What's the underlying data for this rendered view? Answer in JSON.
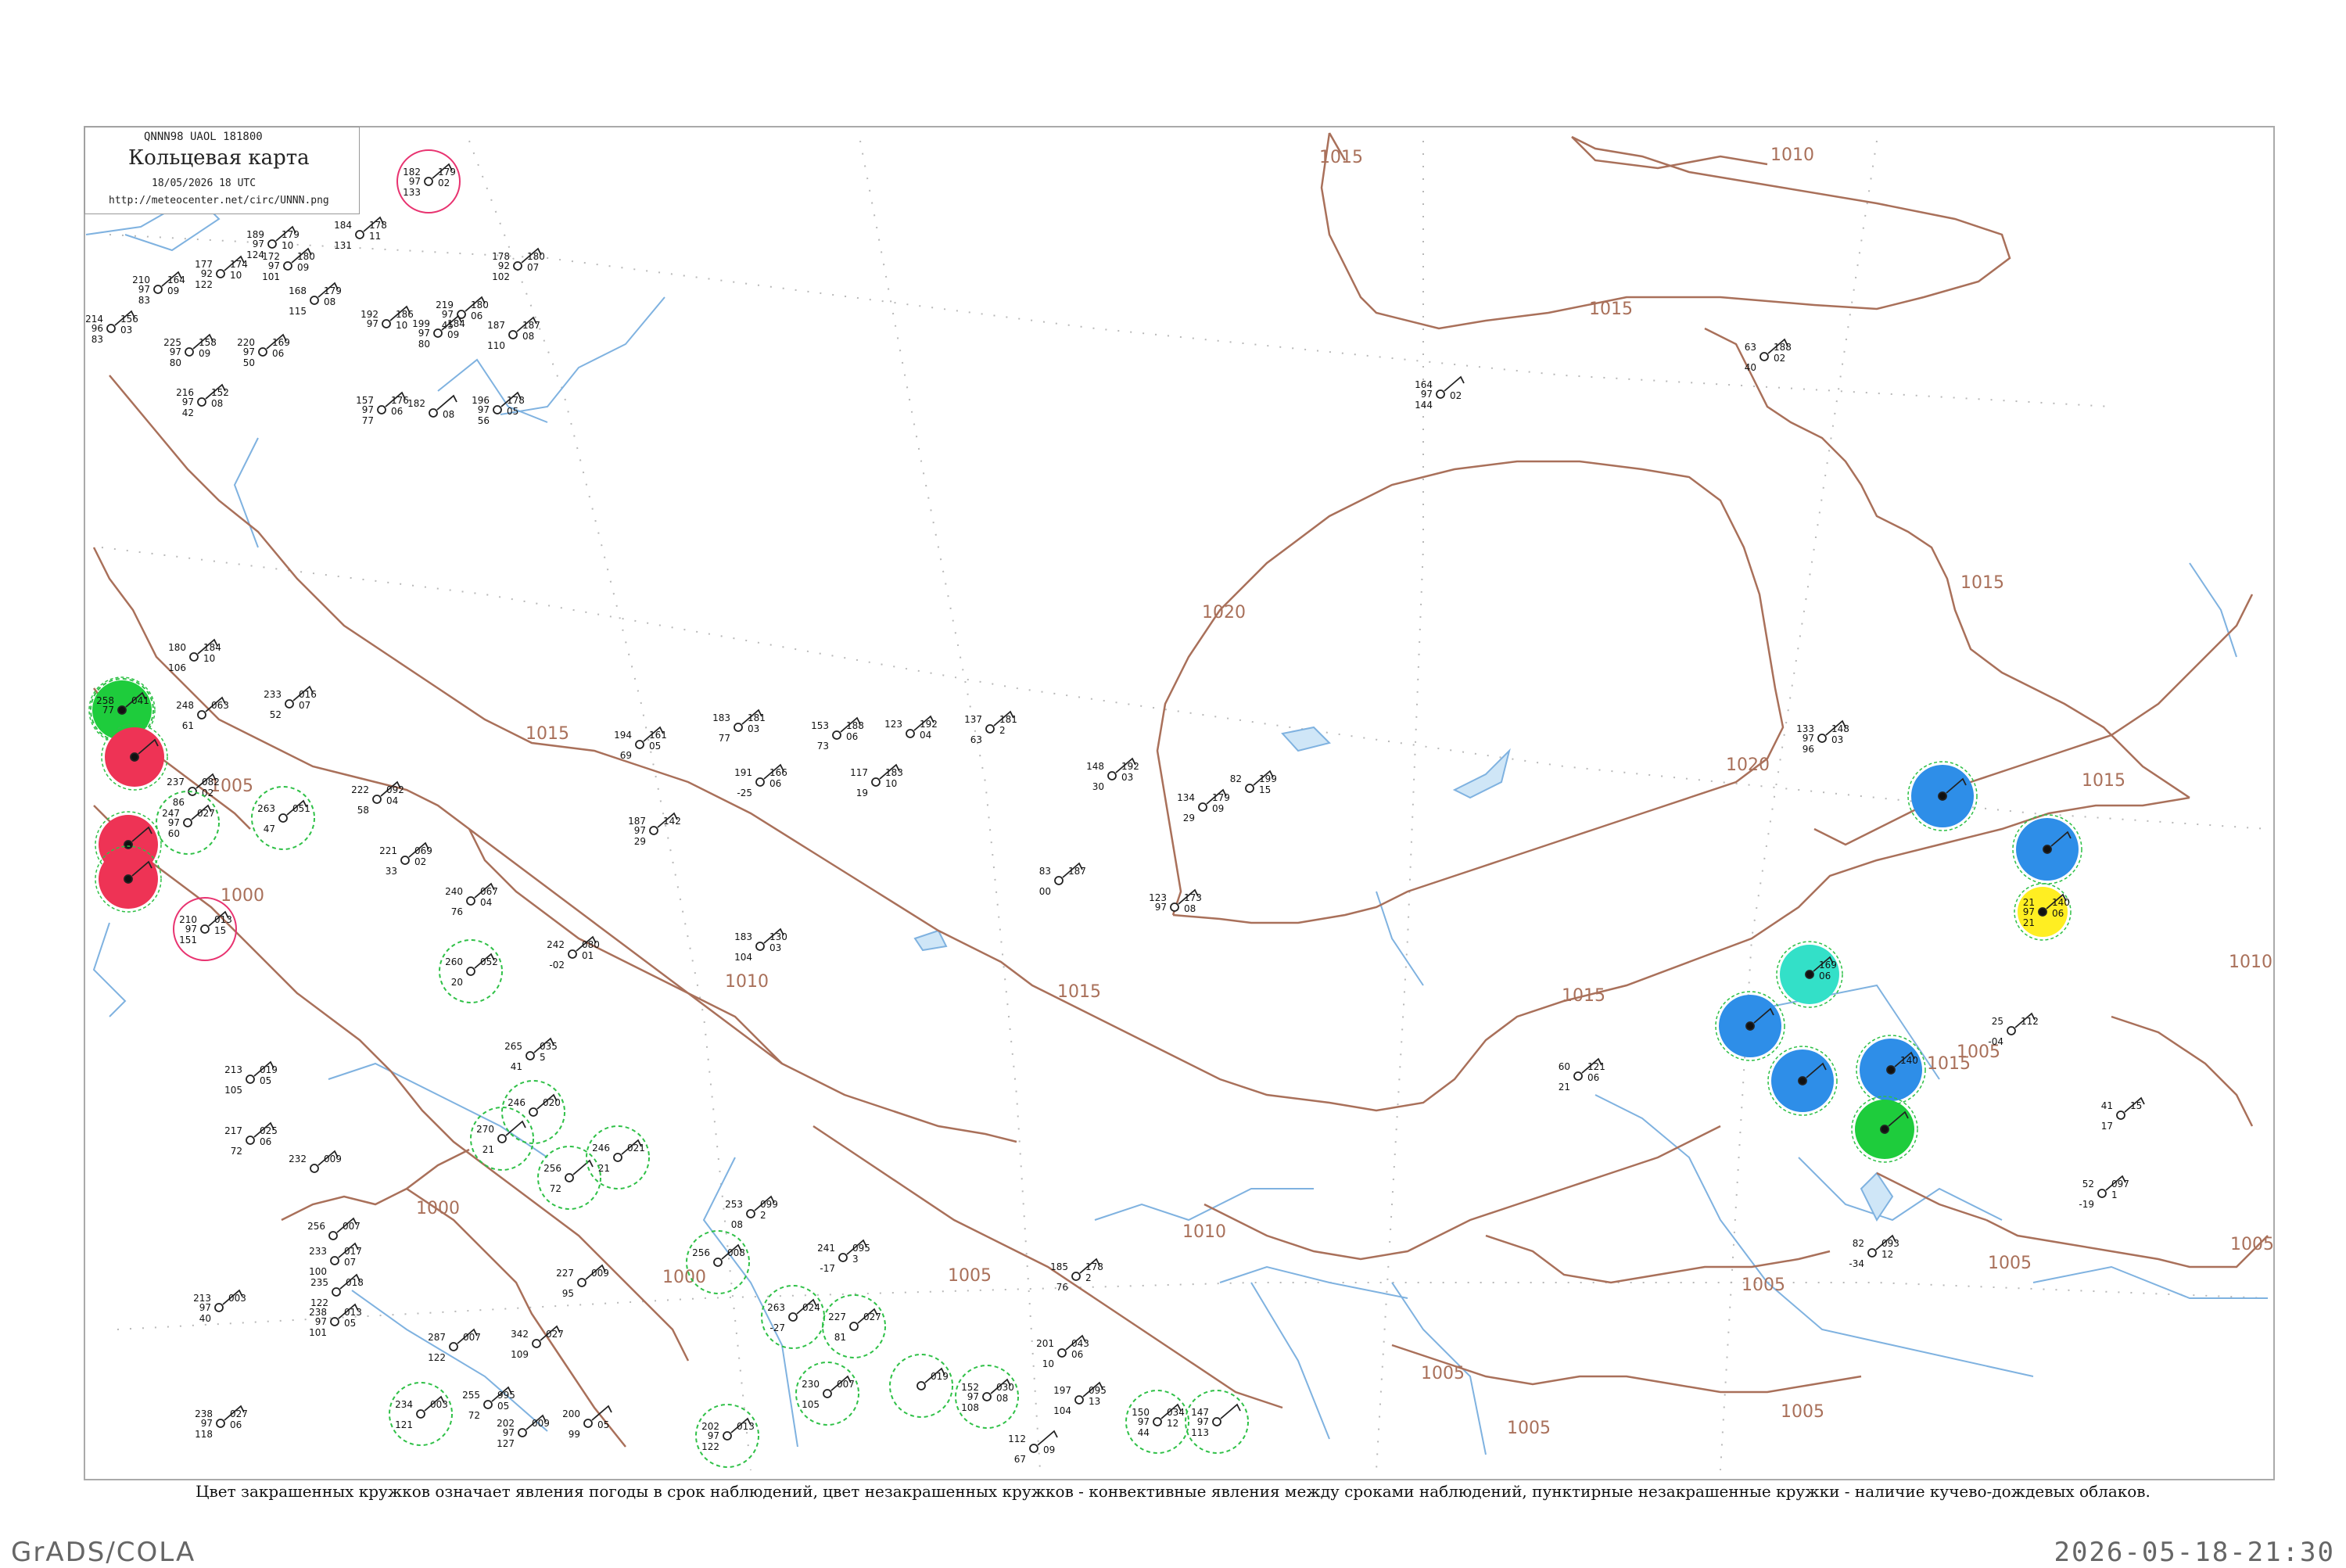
{
  "header": {
    "codes": "QNNN98  UAOL  181800",
    "title": "Кольцевая карта",
    "datetime": "18/05/2026 18 UTC",
    "url": "http://meteocenter.net/circ/UNNN.png"
  },
  "caption": "Цвет закрашенных кружков означает явления погоды в срок наблюдений, цвет незакрашенных кружков - конвективные явления между сроками наблюдений, пунктирные незакрашенные кружки - наличие кучево-дождевых облаков.",
  "footer": {
    "left": "GrADS/COLA",
    "right": "2026-05-18-21:30"
  },
  "colors": {
    "isobar": "#a9705a",
    "water": "#7fb2e0",
    "station": "#222222",
    "red": "#ee3355",
    "green": "#1ecc3c",
    "blue": "#2e8ee8",
    "cyan": "#33e0c8",
    "yellow": "#ffee22",
    "cb_ring": "#2ec046",
    "ts_ring": "#e83370"
  },
  "isobar_labels": [
    {
      "text": "1015"
    },
    {
      "text": "1010"
    },
    {
      "text": "1015"
    },
    {
      "text": "1015"
    },
    {
      "text": "1020"
    },
    {
      "text": "1020"
    },
    {
      "text": "1015"
    },
    {
      "text": "1015"
    },
    {
      "text": "1015"
    },
    {
      "text": "1010"
    },
    {
      "text": "1015"
    },
    {
      "text": "1005"
    },
    {
      "text": "1005"
    },
    {
      "text": "1000"
    },
    {
      "text": "1010"
    },
    {
      "text": "1015"
    },
    {
      "text": "1000"
    },
    {
      "text": "1000"
    },
    {
      "text": "1005"
    },
    {
      "text": "1010"
    },
    {
      "text": "1005"
    },
    {
      "text": "1005"
    },
    {
      "text": "1005"
    },
    {
      "text": "1005"
    },
    {
      "text": "1005"
    },
    {
      "text": "1005"
    }
  ],
  "stations": [
    {
      "p": "182",
      "t": "97",
      "d": "133",
      "w": "179",
      "v": "02",
      "ring": "ts"
    },
    {
      "p": "189",
      "t": "97",
      "d": "124",
      "w": "179",
      "v": "10"
    },
    {
      "p": "184",
      "t": "",
      "d": "131",
      "w": "178",
      "v": "11"
    },
    {
      "p": "177",
      "t": "92",
      "d": "122",
      "w": "174",
      "v": "10"
    },
    {
      "p": "172",
      "t": "97",
      "d": "101",
      "w": "180",
      "v": "09"
    },
    {
      "p": "210",
      "t": "97",
      "d": "83",
      "w": "164",
      "v": "09"
    },
    {
      "p": "168",
      "t": "",
      "d": "115",
      "w": "179",
      "v": "08"
    },
    {
      "p": "178",
      "t": "92",
      "d": "102",
      "w": "180",
      "v": "07"
    },
    {
      "p": "192",
      "t": "97",
      "d": "",
      "w": "186",
      "v": "10"
    },
    {
      "p": "219",
      "t": "97",
      "d": "45",
      "w": "180",
      "v": "06"
    },
    {
      "p": "199",
      "t": "97",
      "d": "80",
      "w": "184",
      "v": "09"
    },
    {
      "p": "187",
      "t": "",
      "d": "110",
      "w": "187",
      "v": "08"
    },
    {
      "p": "214",
      "t": "96",
      "d": "83",
      "w": "156",
      "v": "03"
    },
    {
      "p": "225",
      "t": "97",
      "d": "80",
      "w": "158",
      "v": "09"
    },
    {
      "p": "220",
      "t": "97",
      "d": "50",
      "w": "169",
      "v": "06"
    },
    {
      "p": "216",
      "t": "97",
      "d": "42",
      "w": "152",
      "v": "08"
    },
    {
      "p": "157",
      "t": "97",
      "d": "77",
      "w": "176",
      "v": "06"
    },
    {
      "p": "182",
      "t": "",
      "d": "",
      "w": "",
      "v": "08"
    },
    {
      "p": "196",
      "t": "97",
      "d": "56",
      "w": "178",
      "v": "05"
    },
    {
      "p": "164",
      "t": "97",
      "d": "144",
      "w": "",
      "v": "02"
    },
    {
      "p": "63",
      "t": "",
      "d": "40",
      "w": "188",
      "v": "02"
    },
    {
      "p": "180",
      "t": "",
      "d": "106",
      "w": "184",
      "v": "10"
    },
    {
      "p": "233",
      "t": "",
      "d": "52",
      "w": "016",
      "v": "07"
    },
    {
      "p": "258",
      "t": "77",
      "d": "",
      "w": "041",
      "v": "",
      "ring": "cb",
      "fill": "green"
    },
    {
      "p": "248",
      "t": "",
      "d": "61",
      "w": "063",
      "v": ""
    },
    {
      "p": "",
      "t": "",
      "d": "",
      "w": "",
      "v": "",
      "fill": "red"
    },
    {
      "p": "237",
      "t": "",
      "d": "86",
      "w": "082",
      "v": "02"
    },
    {
      "p": "222",
      "t": "",
      "d": "58",
      "w": "092",
      "v": "04"
    },
    {
      "p": "263",
      "t": "",
      "d": "47",
      "w": "051",
      "v": "",
      "ring": "cb"
    },
    {
      "p": "247",
      "t": "97",
      "d": "60",
      "w": "027",
      "v": "",
      "ring": "cb"
    },
    {
      "p": "",
      "t": "",
      "d": "",
      "w": "",
      "v": "",
      "fill": "red"
    },
    {
      "p": "",
      "t": "",
      "d": "",
      "w": "",
      "v": "",
      "fill": "red"
    },
    {
      "p": "221",
      "t": "",
      "d": "33",
      "w": "069",
      "v": "02"
    },
    {
      "p": "240",
      "t": "",
      "d": "76",
      "w": "067",
      "v": "04"
    },
    {
      "p": "210",
      "t": "97",
      "d": "151",
      "w": "013",
      "v": "15",
      "ring": "ts"
    },
    {
      "p": "242",
      "t": "",
      "d": "-02",
      "w": "080",
      "v": "01"
    },
    {
      "p": "260",
      "t": "",
      "d": "20",
      "w": "052",
      "v": "",
      "ring": "cb"
    },
    {
      "p": "194",
      "t": "",
      "d": "69",
      "w": "161",
      "v": "05"
    },
    {
      "p": "187",
      "t": "97",
      "d": "29",
      "w": "142",
      "v": ""
    },
    {
      "p": "183",
      "t": "",
      "d": "77",
      "w": "181",
      "v": "03"
    },
    {
      "p": "191",
      "t": "",
      "d": "-25",
      "w": "166",
      "v": "06"
    },
    {
      "p": "153",
      "t": "",
      "d": "73",
      "w": "188",
      "v": "06"
    },
    {
      "p": "117",
      "t": "",
      "d": "19",
      "w": "183",
      "v": "10"
    },
    {
      "p": "123",
      "t": "",
      "d": "",
      "w": "192",
      "v": "04"
    },
    {
      "p": "137",
      "t": "",
      "d": "63",
      "w": "181",
      "v": "2"
    },
    {
      "p": "183",
      "t": "",
      "d": "104",
      "w": "130",
      "v": "03"
    },
    {
      "p": "148",
      "t": "",
      "d": "30",
      "w": "192",
      "v": "03"
    },
    {
      "p": "134",
      "t": "",
      "d": "29",
      "w": "179",
      "v": "09"
    },
    {
      "p": "82",
      "t": "",
      "d": "",
      "w": "199",
      "v": "15"
    },
    {
      "p": "83",
      "t": "",
      "d": "00",
      "w": "187",
      "v": ""
    },
    {
      "p": "123",
      "t": "97",
      "d": "",
      "w": "173",
      "v": "08"
    },
    {
      "p": "265",
      "t": "",
      "d": "41",
      "w": "035",
      "v": "5"
    },
    {
      "p": "213",
      "t": "",
      "d": "105",
      "w": "019",
      "v": "05"
    },
    {
      "p": "217",
      "t": "",
      "d": "72",
      "w": "025",
      "v": "06"
    },
    {
      "p": "232",
      "t": "",
      "d": "",
      "w": "009",
      "v": ""
    },
    {
      "p": "246",
      "t": "",
      "d": "",
      "w": "020",
      "v": "",
      "ring": "cb"
    },
    {
      "p": "270",
      "t": "",
      "d": "21",
      "w": "",
      "v": "",
      "ring": "cb"
    },
    {
      "p": "256",
      "t": "",
      "d": "72",
      "w": "",
      "v": "",
      "ring": "cb"
    },
    {
      "p": "246",
      "t": "",
      "d": "21",
      "w": "021",
      "v": "",
      "ring": "cb"
    },
    {
      "p": "256",
      "t": "",
      "d": "",
      "w": "007",
      "v": ""
    },
    {
      "p": "233",
      "t": "",
      "d": "100",
      "w": "017",
      "v": "07"
    },
    {
      "p": "235",
      "t": "",
      "d": "122",
      "w": "018",
      "v": ""
    },
    {
      "p": "238",
      "t": "97",
      "d": "101",
      "w": "013",
      "v": "05"
    },
    {
      "p": "213",
      "t": "97",
      "d": "40",
      "w": "003",
      "v": ""
    },
    {
      "p": "287",
      "t": "",
      "d": "122",
      "w": "007",
      "v": ""
    },
    {
      "p": "342",
      "t": "",
      "d": "109",
      "w": "027",
      "v": ""
    },
    {
      "p": "227",
      "t": "",
      "d": "95",
      "w": "009",
      "v": ""
    },
    {
      "p": "253",
      "t": "",
      "d": "08",
      "w": "099",
      "v": "2"
    },
    {
      "p": "241",
      "t": "",
      "d": "-17",
      "w": "095",
      "v": "3"
    },
    {
      "p": "256",
      "t": "",
      "d": "",
      "w": "008",
      "v": "",
      "ring": "cb"
    },
    {
      "p": "263",
      "t": "",
      "d": "-27",
      "w": "024",
      "v": "",
      "ring": "cb"
    },
    {
      "p": "227",
      "t": "",
      "d": "81",
      "w": "027",
      "v": "",
      "ring": "cb"
    },
    {
      "p": "230",
      "t": "",
      "d": "105",
      "w": "007",
      "v": "",
      "ring": "cb"
    },
    {
      "p": "",
      "t": "",
      "d": "",
      "w": "019",
      "v": "",
      "ring": "cb"
    },
    {
      "p": "152",
      "t": "97",
      "d": "108",
      "w": "030",
      "v": "08",
      "ring": "cb"
    },
    {
      "p": "201",
      "t": "",
      "d": "10",
      "w": "043",
      "v": "06"
    },
    {
      "p": "185",
      "t": "",
      "d": "76",
      "w": "178",
      "v": "2"
    },
    {
      "p": "197",
      "t": "",
      "d": "104",
      "w": "095",
      "v": "13"
    },
    {
      "p": "112",
      "t": "",
      "d": "67",
      "w": "",
      "v": "09"
    },
    {
      "p": "150",
      "t": "97",
      "d": "44",
      "w": "034",
      "v": "12",
      "ring": "cb"
    },
    {
      "p": "147",
      "t": "97",
      "d": "113",
      "w": "",
      "v": "",
      "ring": "cb"
    },
    {
      "p": "234",
      "t": "",
      "d": "121",
      "w": "003",
      "v": "",
      "ring": "cb"
    },
    {
      "p": "255",
      "t": "",
      "d": "72",
      "w": "995",
      "v": "05"
    },
    {
      "p": "202",
      "t": "97",
      "d": "127",
      "w": "009",
      "v": ""
    },
    {
      "p": "200",
      "t": "",
      "d": "99",
      "w": "",
      "v": "05"
    },
    {
      "p": "238",
      "t": "97",
      "d": "118",
      "w": "027",
      "v": "06"
    },
    {
      "p": "202",
      "t": "97",
      "d": "122",
      "w": "013",
      "v": "",
      "ring": "cb"
    },
    {
      "p": "133",
      "t": "97",
      "d": "96",
      "w": "148",
      "v": "03"
    },
    {
      "p": "",
      "t": "",
      "d": "",
      "w": "",
      "v": "",
      "fill": "blue"
    },
    {
      "p": "",
      "t": "",
      "d": "",
      "w": "",
      "v": "",
      "fill": "blue"
    },
    {
      "p": "21",
      "t": "97",
      "d": "21",
      "w": "140",
      "v": "06",
      "fill": "yellow"
    },
    {
      "p": "",
      "t": "",
      "d": "",
      "w": "169",
      "v": "06",
      "fill": "cyan"
    },
    {
      "p": "",
      "t": "",
      "d": "",
      "w": "",
      "v": "",
      "fill": "blue"
    },
    {
      "p": "",
      "t": "",
      "d": "",
      "w": "",
      "v": "",
      "fill": "blue"
    },
    {
      "p": "",
      "t": "",
      "d": "",
      "w": "140",
      "v": "",
      "fill": "blue"
    },
    {
      "p": "",
      "t": "",
      "d": "",
      "w": "",
      "v": "",
      "fill": "green"
    },
    {
      "p": "25",
      "t": "",
      "d": "-04",
      "w": "112",
      "v": ""
    },
    {
      "p": "60",
      "t": "",
      "d": "21",
      "w": "121",
      "v": "06"
    },
    {
      "p": "41",
      "t": "",
      "d": "17",
      "w": "15",
      "v": ""
    },
    {
      "p": "52",
      "t": "",
      "d": "-19",
      "w": "097",
      "v": "1"
    },
    {
      "p": "82",
      "t": "",
      "d": "-34",
      "w": "093",
      "v": "12"
    }
  ]
}
